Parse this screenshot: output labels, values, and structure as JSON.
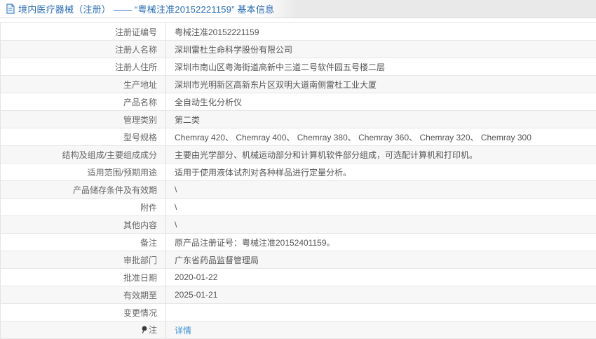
{
  "header": {
    "icon": "document-icon",
    "title": "境内医疗器械（注册） —— “粤械注准20152221159” 基本信息",
    "title_color": "#2a6db5",
    "bar_bg": "#e9e9e9"
  },
  "colors": {
    "row_alt_bg": "#f7f7f7",
    "row_border": "#e7e7e7",
    "label_text": "#666666",
    "value_text": "#555555",
    "link_blue": "#4191d6",
    "title_blue": "#2a6db5"
  },
  "table": {
    "rows": [
      {
        "label": "注册证编号",
        "value": "粤械注准20152221159"
      },
      {
        "label": "注册人名称",
        "value": "深圳雷杜生命科学股份有限公司"
      },
      {
        "label": "注册人住所",
        "value": "深圳市南山区粤海街道高新中三道二号软件园五号楼二层"
      },
      {
        "label": "生产地址",
        "value": "深圳市光明新区高新东片区双明大道南侧雷杜工业大厦"
      },
      {
        "label": "产品名称",
        "value": "全自动生化分析仪"
      },
      {
        "label": "管理类别",
        "value": "第二类"
      },
      {
        "label": "型号规格",
        "value": "Chemray 420、 Chemray 400、 Chemray 380、 Chemray 360、 Chemray 320、 Chemray 300"
      },
      {
        "label": "结构及组成/主要组成成分",
        "value": "主要由光学部分、机械运动部分和计算机软件部分组成，可选配计算机和打印机。"
      },
      {
        "label": "适用范围/预期用途",
        "value": "适用于使用液体试剂对各种样品进行定量分析。"
      },
      {
        "label": "产品储存条件及有效期",
        "value": "\\"
      },
      {
        "label": "附件",
        "value": "\\"
      },
      {
        "label": "其他内容",
        "value": "\\"
      },
      {
        "label": "备注",
        "value": "原产品注册证号：粤械注准20152401159。"
      },
      {
        "label": "审批部门",
        "value": "广东省药品监督管理局"
      },
      {
        "label": "批准日期",
        "value": "2020-01-22"
      },
      {
        "label": "有效期至",
        "value": "2025-01-21"
      },
      {
        "label": "变更情况",
        "value": ""
      },
      {
        "label": "注",
        "icon": "pin-icon",
        "value_link": "详情"
      }
    ]
  }
}
